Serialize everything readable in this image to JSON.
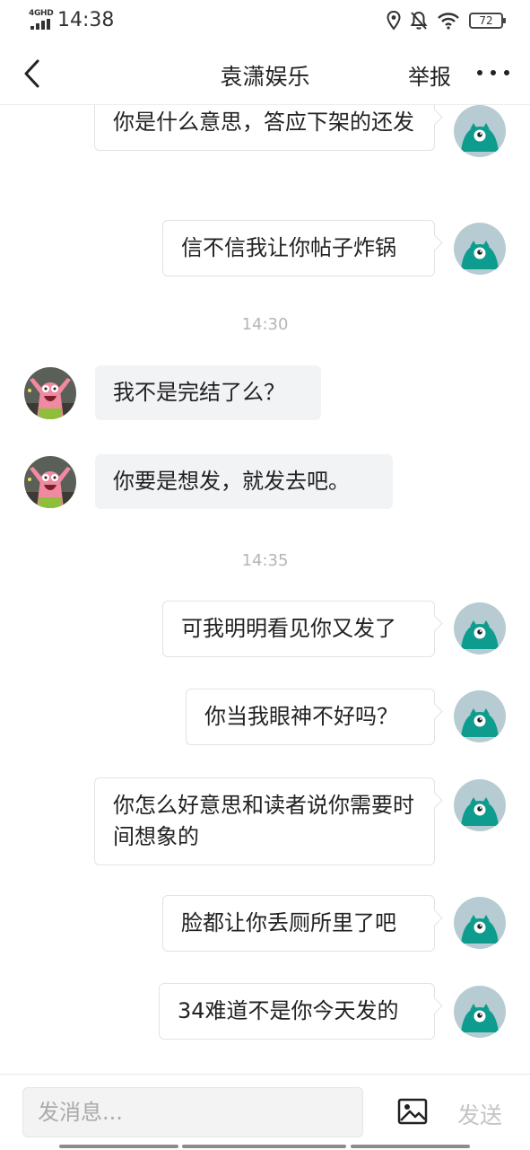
{
  "status_bar": {
    "network": "4GHD",
    "time": "14:38",
    "battery": "72"
  },
  "nav": {
    "title": "袁潇娱乐",
    "report_label": "举报"
  },
  "colors": {
    "teal_avatar_bg": "#b7ccd2",
    "teal_monster": "#0d9c8d"
  },
  "messages": [
    {
      "side": "out",
      "text": "你是什么意思，答应下架的还发"
    },
    {
      "side": "out",
      "text": "信不信我让你帖子炸锅"
    },
    {
      "timestamp": "14:30"
    },
    {
      "side": "in",
      "text": "我不是完结了么？"
    },
    {
      "side": "in",
      "text": "你要是想发，就发去吧。"
    },
    {
      "timestamp": "14:35"
    },
    {
      "side": "out",
      "text": "可我明明看见你又发了"
    },
    {
      "side": "out",
      "text": "你当我眼神不好吗？"
    },
    {
      "side": "out",
      "text": "你怎么好意思和读者说你需要时间想象的"
    },
    {
      "side": "out",
      "text": "脸都让你丢厕所里了吧"
    },
    {
      "side": "out",
      "text": "34难道不是你今天发的"
    }
  ],
  "input": {
    "placeholder": "发消息...",
    "send_label": "发送"
  }
}
